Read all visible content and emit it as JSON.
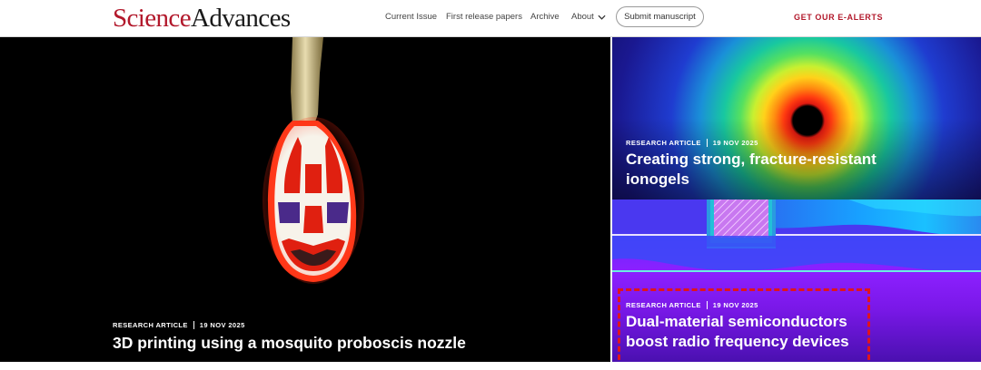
{
  "header": {
    "logo_part1": "Science",
    "logo_part2": "Advances",
    "nav": {
      "current_issue": "Current Issue",
      "first_release": "First release papers",
      "archive": "Archive",
      "about": "About"
    },
    "submit_label": "Submit manuscript",
    "ealerts_label": "GET OUR E-ALERTS"
  },
  "hero": {
    "main": {
      "type": "RESEARCH ARTICLE",
      "date": "19 NOV 2025",
      "title": "3D printing using a mosquito proboscis nozzle"
    },
    "side_top": {
      "type": "RESEARCH ARTICLE",
      "date": "19 NOV 2025",
      "title_line1": "Creating strong, fracture-resistant",
      "title_line2": "ionogels"
    },
    "side_bottom": {
      "type": "RESEARCH ARTICLE",
      "date": "19 NOV 2025",
      "title_line1": "Dual-material semiconductors",
      "title_line2": "boost radio frequency devices"
    }
  },
  "colors": {
    "brand_red": "#b2182b",
    "highlight_red": "#e0141c"
  },
  "icons": {
    "about_menu": "chevron-down-icon"
  }
}
